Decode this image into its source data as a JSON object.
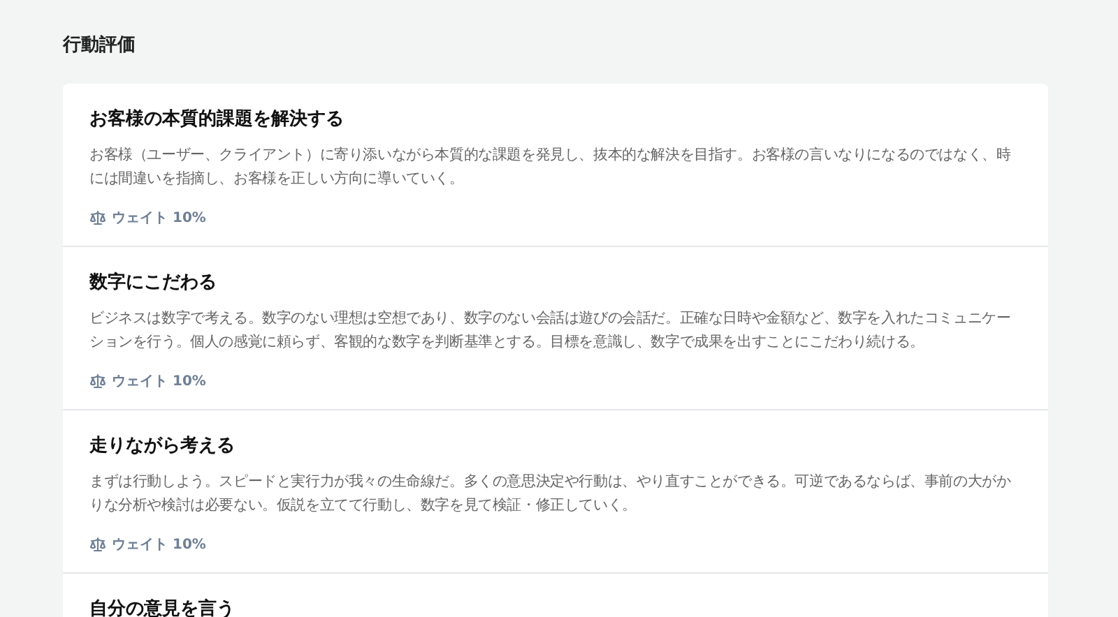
{
  "heading": "行動評価",
  "items": [
    {
      "title": "お客様の本質的課題を解決する",
      "description": "お客様（ユーザー、クライアント）に寄り添いながら本質的な課題を発見し、抜本的な解決を目指す。お客様の言いなりになるのではなく、時には間違いを指摘し、お客様を正しい方向に導いていく。",
      "weight": "ウェイト 10%"
    },
    {
      "title": "数字にこだわる",
      "description": "ビジネスは数字で考える。数字のない理想は空想であり、数字のない会話は遊びの会話だ。正確な日時や金額など、数字を入れたコミュニケーションを行う。個人の感覚に頼らず、客観的な数字を判断基準とする。目標を意識し、数字で成果を出すことにこだわり続ける。",
      "weight": "ウェイト 10%"
    },
    {
      "title": "走りながら考える",
      "description": "まずは行動しよう。スピードと実行力が我々の生命線だ。多くの意思決定や行動は、やり直すことができる。可逆であるならば、事前の大がかりな分析や検討は必要ない。仮説を立てて行動し、数字を見て検証・修正していく。",
      "weight": "ウェイト 10%"
    },
    {
      "title": "自分の意見を言う"
    }
  ]
}
